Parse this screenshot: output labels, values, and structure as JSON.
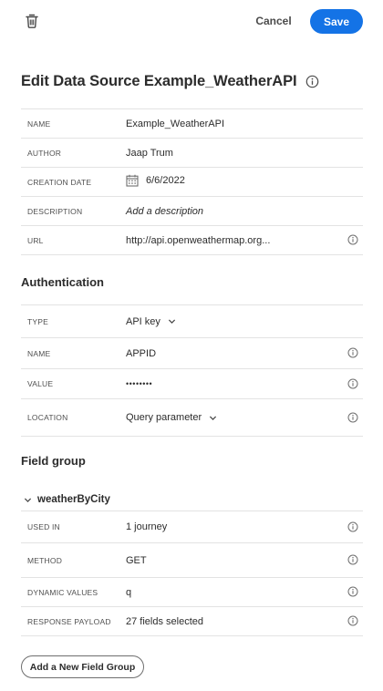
{
  "toolbar": {
    "cancel_label": "Cancel",
    "save_label": "Save",
    "delete_icon": "trash-icon",
    "accent_color": "#1473e6"
  },
  "title": "Edit Data Source Example_WeatherAPI",
  "details": {
    "name_label": "NAME",
    "name_value": "Example_WeatherAPI",
    "author_label": "AUTHOR",
    "author_value": "Jaap Trum",
    "creation_date_label": "CREATION DATE",
    "creation_date_value": "6/6/2022",
    "description_label": "DESCRIPTION",
    "description_placeholder": "Add a description",
    "url_label": "URL",
    "url_value": "http://api.openweathermap.org..."
  },
  "authentication": {
    "section_title": "Authentication",
    "type_label": "TYPE",
    "type_value": "API key",
    "name_label": "NAME",
    "name_value": "APPID",
    "value_label": "VALUE",
    "value_value": "••••••••",
    "location_label": "LOCATION",
    "location_value": "Query parameter"
  },
  "field_group": {
    "section_title": "Field group",
    "group_name": "weatherByCity",
    "used_in_label": "USED IN",
    "used_in_value": "1 journey",
    "method_label": "METHOD",
    "method_value": "GET",
    "dynamic_values_label": "DYNAMIC VALUES",
    "dynamic_values_value": "q",
    "response_payload_label": "RESPONSE PAYLOAD",
    "response_payload_value": "27 fields selected",
    "add_button_label": "Add a New Field Group"
  }
}
